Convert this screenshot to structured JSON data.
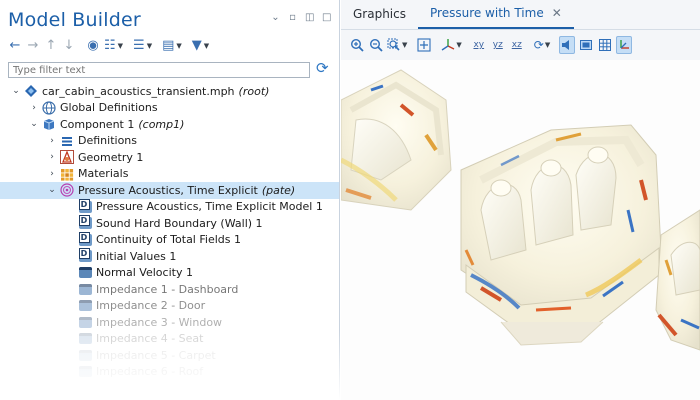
{
  "model_builder": {
    "title": "Model Builder",
    "filter_placeholder": "Type filter text",
    "tree": [
      {
        "label": "car_cabin_acoustics_transient.mph",
        "tag": "(root)",
        "icon": "root-icon",
        "depth": 0,
        "expanded": true
      },
      {
        "label": "Global Definitions",
        "tag": "",
        "icon": "globe-icon",
        "depth": 1,
        "expanded": false
      },
      {
        "label": "Component 1",
        "tag": "(comp1)",
        "icon": "component-icon",
        "depth": 1,
        "expanded": true
      },
      {
        "label": "Definitions",
        "tag": "",
        "icon": "definitions-icon",
        "depth": 2,
        "expanded": false
      },
      {
        "label": "Geometry 1",
        "tag": "",
        "icon": "geometry-icon",
        "depth": 2,
        "expanded": false
      },
      {
        "label": "Materials",
        "tag": "",
        "icon": "materials-icon",
        "depth": 2,
        "expanded": false
      },
      {
        "label": "Pressure Acoustics, Time Explicit",
        "tag": "(pate)",
        "icon": "acoustics-icon",
        "depth": 2,
        "expanded": true,
        "selected": true
      },
      {
        "label": "Pressure Acoustics, Time Explicit Model 1",
        "tag": "",
        "icon": "default-node-icon",
        "depth": 3
      },
      {
        "label": "Sound Hard Boundary (Wall) 1",
        "tag": "",
        "icon": "default-node-icon",
        "depth": 3
      },
      {
        "label": "Continuity of Total Fields 1",
        "tag": "",
        "icon": "default-node-icon",
        "depth": 3
      },
      {
        "label": "Initial Values 1",
        "tag": "",
        "icon": "default-node-icon",
        "depth": 3
      },
      {
        "label": "Normal Velocity 1",
        "tag": "",
        "icon": "boundary-node-icon",
        "depth": 3
      },
      {
        "label": "Impedance 1 - Dashboard",
        "tag": "",
        "icon": "boundary-node-icon",
        "depth": 3
      },
      {
        "label": "Impedance 2 - Door",
        "tag": "",
        "icon": "boundary-node-icon",
        "depth": 3
      },
      {
        "label": "Impedance 3 - Window",
        "tag": "",
        "icon": "boundary-node-icon",
        "depth": 3
      },
      {
        "label": "Impedance 4 - Seat",
        "tag": "",
        "icon": "boundary-node-icon",
        "depth": 3
      },
      {
        "label": "Impedance 5 - Carpet",
        "tag": "",
        "icon": "boundary-node-icon",
        "depth": 3
      },
      {
        "label": "Impedance 6 - Roof",
        "tag": "",
        "icon": "boundary-node-icon",
        "depth": 3
      }
    ]
  },
  "graphics": {
    "tabs": [
      {
        "label": "Graphics",
        "active": false
      },
      {
        "label": "Pressure with Time",
        "active": true
      }
    ]
  },
  "colors": {
    "accent": "#1c5fa8",
    "selection": "#cce4f8",
    "pressure_high": "#d2552a",
    "pressure_low": "#3b74c4",
    "pressure_mid": "#f3e6a0"
  }
}
